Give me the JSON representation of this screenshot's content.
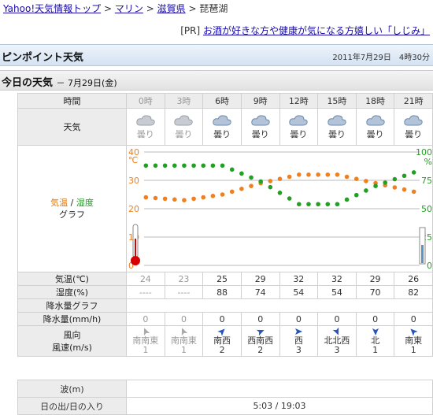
{
  "breadcrumb": {
    "items": [
      "Yahoo!天気情報トップ",
      "マリン",
      "滋賀県"
    ],
    "sep": ">",
    "current": "琵琶湖"
  },
  "pr": {
    "tag": "[PR]",
    "text": "お酒が好きな方や健康が気になる方嬉しい「しじみ」"
  },
  "title": {
    "text": "ピンポイント天気",
    "date": "2011年7月29日　4時30分"
  },
  "today": {
    "text": "今日の天気",
    "sub": "－ 7月29日(金)"
  },
  "labels": {
    "time": "時間",
    "weather": "天気",
    "graph_temp": "気温",
    "graph_sep": " / ",
    "graph_hum": "湿度",
    "graph_word": "グラフ",
    "temp": "気温(℃)",
    "hum": "湿度(%)",
    "precip_graph": "降水量グラフ",
    "precip": "降水量(mm/h)",
    "wind1": "風向",
    "wind2": "風速(m/s)",
    "wave": "波(m)",
    "sun": "日の出/日の入り"
  },
  "columns": [
    {
      "time": "0時",
      "weather": "曇り",
      "temp": "24",
      "hum": "----",
      "precip": "0",
      "dir": "南南東",
      "speed": "1",
      "past": true
    },
    {
      "time": "3時",
      "weather": "曇り",
      "temp": "23",
      "hum": "----",
      "precip": "0",
      "dir": "南南東",
      "speed": "1",
      "past": true
    },
    {
      "time": "6時",
      "weather": "曇り",
      "temp": "25",
      "hum": "88",
      "precip": "0",
      "dir": "南西",
      "speed": "2",
      "past": false
    },
    {
      "time": "9時",
      "weather": "曇り",
      "temp": "29",
      "hum": "74",
      "precip": "0",
      "dir": "西南西",
      "speed": "2",
      "past": false
    },
    {
      "time": "12時",
      "weather": "曇り",
      "temp": "32",
      "hum": "54",
      "precip": "0",
      "dir": "西",
      "speed": "3",
      "past": false
    },
    {
      "time": "15時",
      "weather": "曇り",
      "temp": "32",
      "hum": "54",
      "precip": "0",
      "dir": "北北西",
      "speed": "3",
      "past": false
    },
    {
      "time": "18時",
      "weather": "曇り",
      "temp": "29",
      "hum": "70",
      "precip": "0",
      "dir": "北",
      "speed": "1",
      "past": false
    },
    {
      "time": "21時",
      "weather": "曇り",
      "temp": "26",
      "hum": "82",
      "precip": "0",
      "dir": "南東",
      "speed": "1",
      "past": false
    }
  ],
  "graph": {
    "temp_unit": "℃",
    "hum_unit": "%",
    "temp_ticks": [
      "40",
      "30",
      "20",
      "10",
      "0"
    ],
    "hum_ticks": [
      "100",
      "75",
      "50",
      "25",
      "0"
    ],
    "temp_series": [
      24,
      23,
      25,
      29,
      32,
      32,
      29,
      26
    ],
    "hum_series": [
      null,
      null,
      88,
      74,
      54,
      54,
      70,
      82
    ],
    "colors": {
      "temp": "#f07f1d",
      "hum": "#22a022",
      "grid": "#bbbbbb"
    }
  },
  "sun": {
    "value": "5:03 / 19:03"
  },
  "wave": {
    "value": ""
  }
}
